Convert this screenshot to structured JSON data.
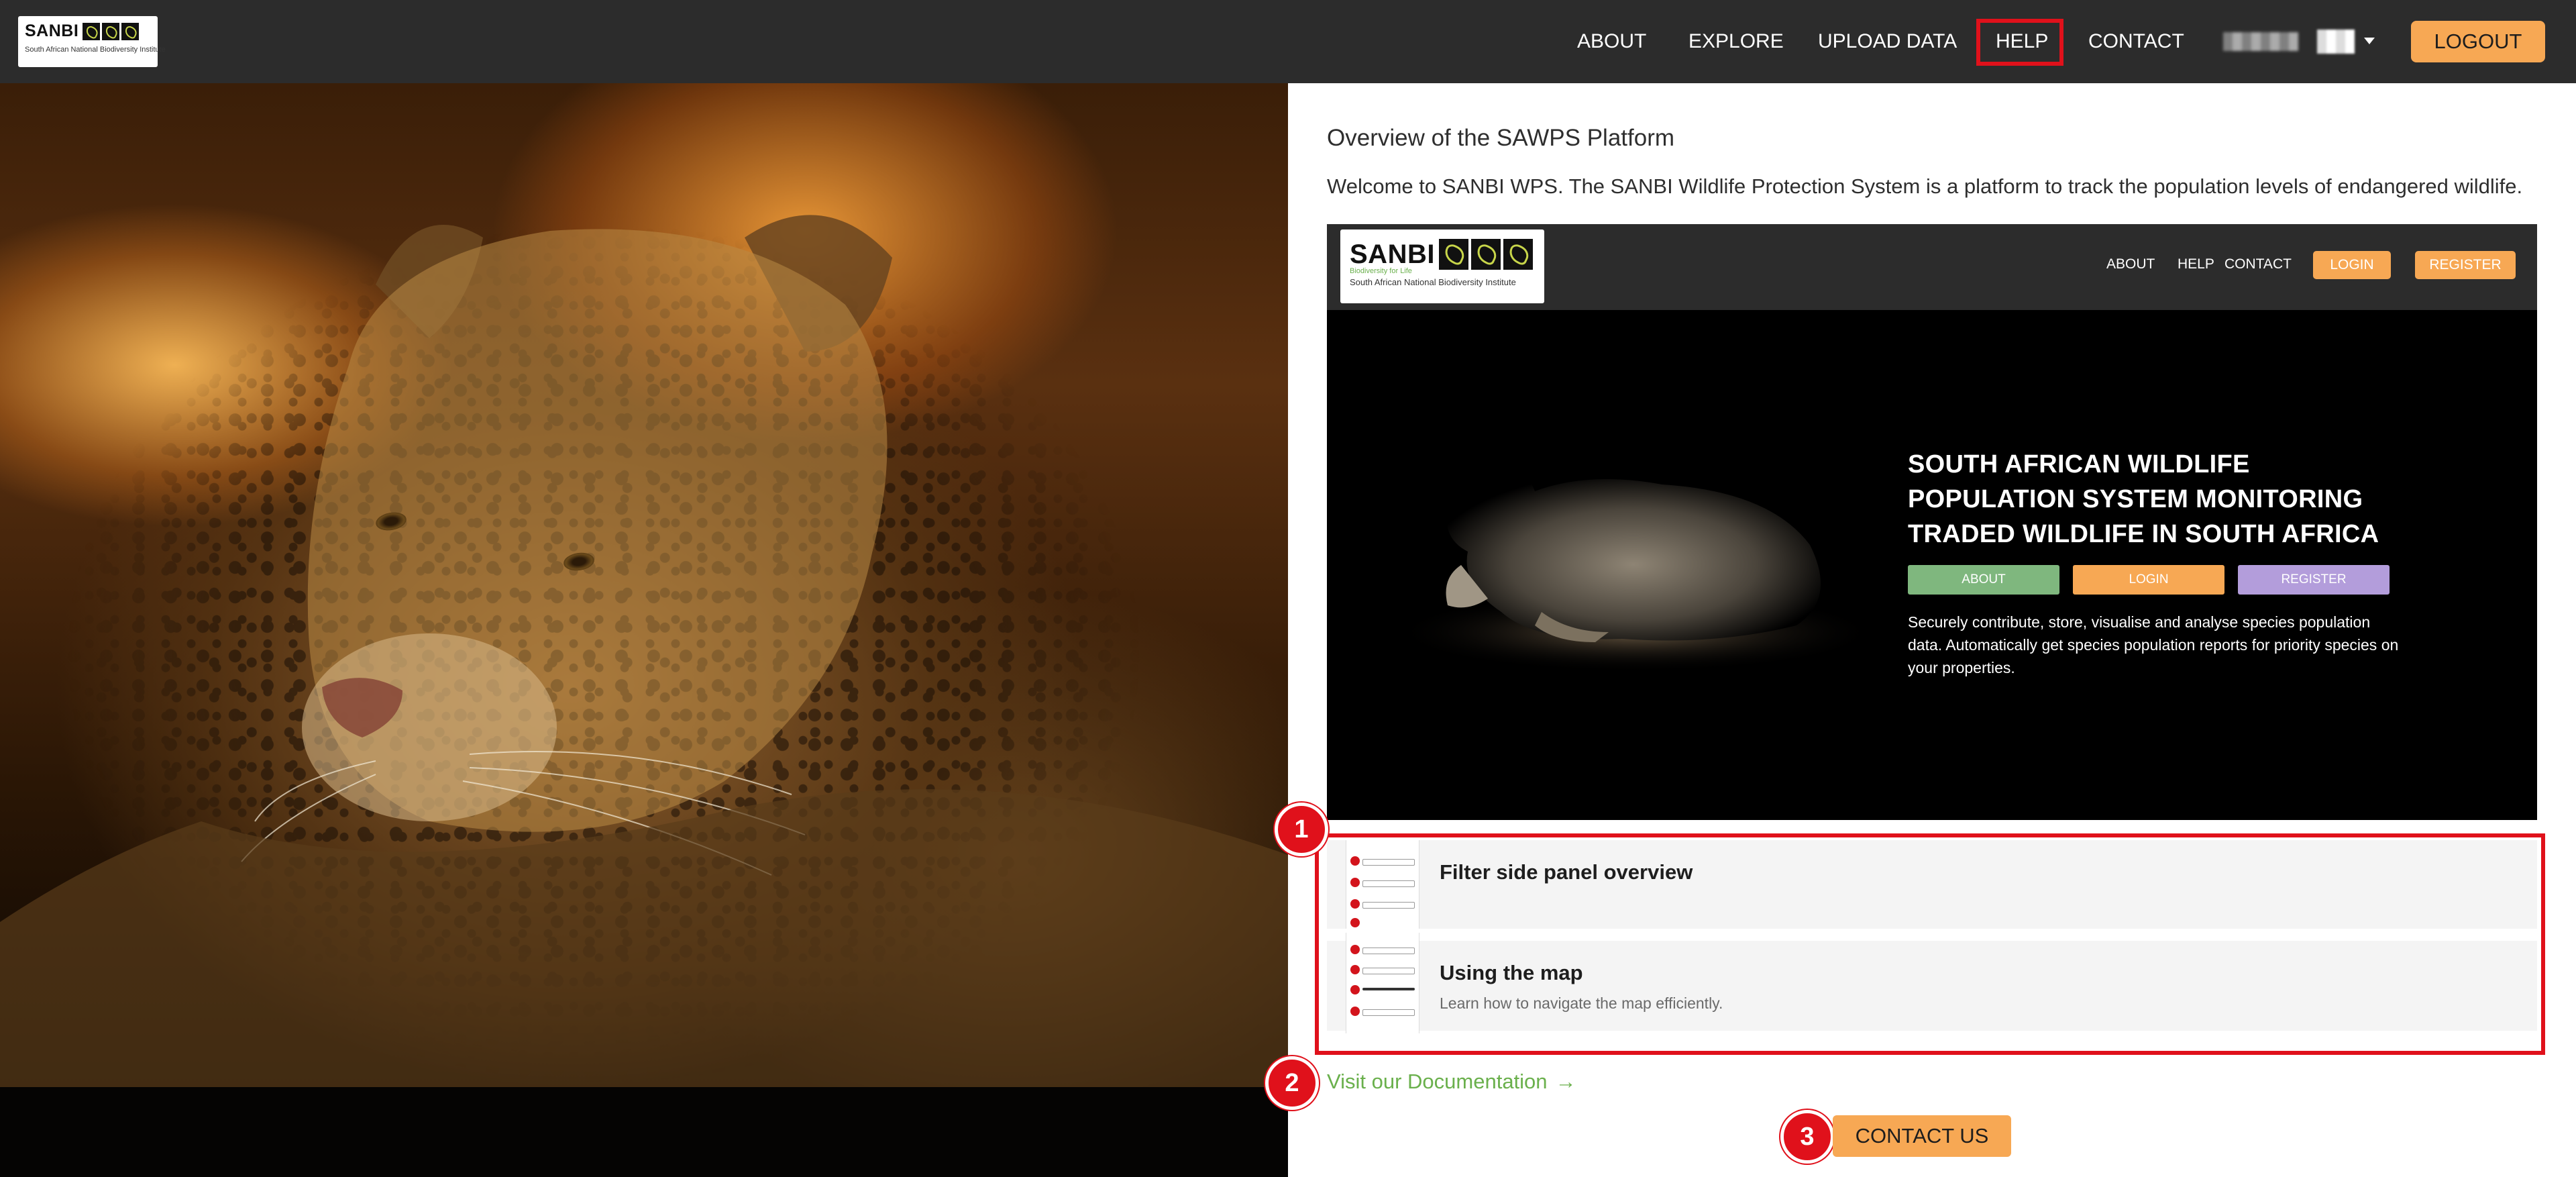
{
  "header": {
    "logo": {
      "word": "SANBI",
      "subtitle": "South African National Biodiversity Institute"
    },
    "nav": [
      {
        "label": "ABOUT"
      },
      {
        "label": "EXPLORE"
      },
      {
        "label": "UPLOAD DATA"
      },
      {
        "label": "HELP",
        "highlighted": true
      },
      {
        "label": "CONTACT"
      }
    ],
    "user_menu_icon": "chevron-down-icon",
    "logout_label": "LOGOUT"
  },
  "hero_image": {
    "subject": "leopard-photo"
  },
  "main": {
    "title": "Overview of the SAWPS Platform",
    "welcome": "Welcome to SANBI WPS. The SANBI Wildlife Protection System is a platform to track the population levels of endangered wildlife.",
    "preview": {
      "logo_word": "SANBI",
      "logo_tag": "Biodiversity for Life",
      "logo_subtitle": "South African National Biodiversity Institute",
      "nav": [
        "ABOUT",
        "HELP",
        "CONTACT"
      ],
      "login_label": "LOGIN",
      "register_label": "REGISTER",
      "headline": "SOUTH AFRICAN WILDLIFE POPULATION SYSTEM MONITORING TRADED WILDLIFE IN SOUTH AFRICA",
      "cta_buttons": [
        {
          "label": "ABOUT",
          "color": "#7fb77e"
        },
        {
          "label": "LOGIN",
          "color": "#f7a854"
        },
        {
          "label": "REGISTER",
          "color": "#b39ddb"
        }
      ],
      "description": "Securely contribute, store, visualise and analyse species population data. Automatically get species population reports for priority species on your properties."
    },
    "tutorials": [
      {
        "title": "Filter side panel overview",
        "subtitle": ""
      },
      {
        "title": "Using the map",
        "subtitle": "Learn how to navigate the map efficiently."
      }
    ],
    "doc_link_label": "Visit our Documentation",
    "doc_link_arrow": "→",
    "contact_us_label": "CONTACT US",
    "callouts": [
      "1",
      "2",
      "3"
    ]
  },
  "colors": {
    "accent": "#f7a854",
    "callout_red": "#e0111b",
    "link_green": "#6ab04c",
    "nav_bg": "#2c2c2c"
  }
}
